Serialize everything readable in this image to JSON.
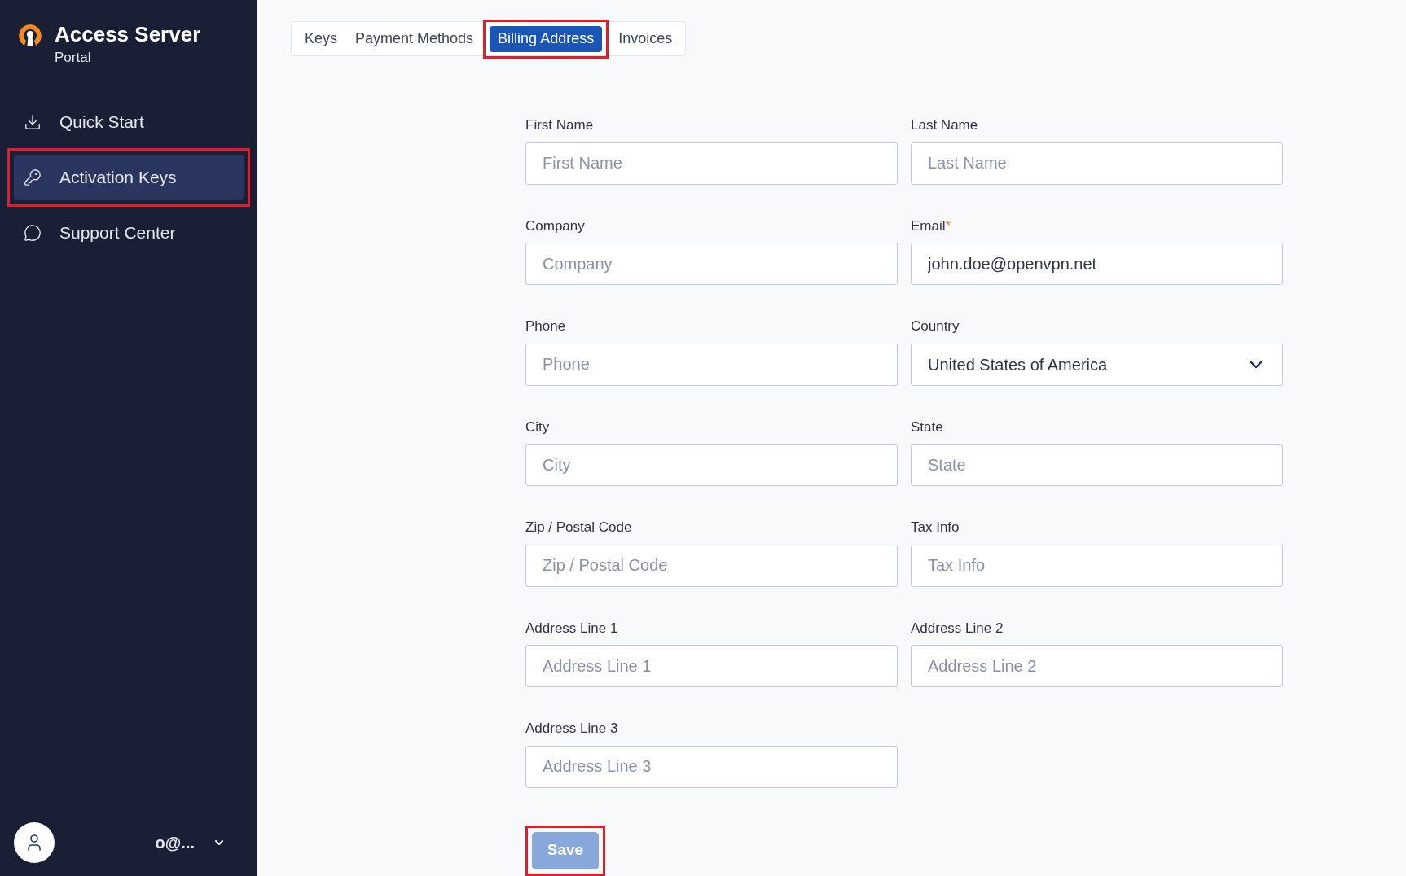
{
  "brand": {
    "title": "Access Server",
    "subtitle": "Portal"
  },
  "nav": [
    {
      "label": "Quick Start",
      "selected": false,
      "highlighted": false
    },
    {
      "label": "Activation Keys",
      "selected": true,
      "highlighted": true
    },
    {
      "label": "Support Center",
      "selected": false,
      "highlighted": false
    }
  ],
  "user": {
    "name": "o@..."
  },
  "tabs": [
    {
      "label": "Keys",
      "selected": false,
      "highlighted": false
    },
    {
      "label": "Payment Methods",
      "selected": false,
      "highlighted": false
    },
    {
      "label": "Billing Address",
      "selected": true,
      "highlighted": true
    },
    {
      "label": "Invoices",
      "selected": false,
      "highlighted": false
    }
  ],
  "fields": [
    {
      "label": "First Name",
      "kind": "text",
      "placeholder": "First Name"
    },
    {
      "label": "Last Name",
      "kind": "text",
      "placeholder": "Last Name"
    },
    {
      "label": "Company",
      "kind": "text",
      "placeholder": "Company"
    },
    {
      "label": "Email",
      "kind": "text",
      "required_mark": "*",
      "value": "john.doe@openvpn.net"
    },
    {
      "label": "Phone",
      "kind": "text",
      "placeholder": "Phone"
    },
    {
      "label": "Country",
      "kind": "select",
      "value": "United States of America"
    },
    {
      "label": "City",
      "kind": "text",
      "placeholder": "City"
    },
    {
      "label": "State",
      "kind": "text",
      "placeholder": "State"
    },
    {
      "label": "Zip / Postal Code",
      "kind": "text",
      "placeholder": "Zip / Postal Code"
    },
    {
      "label": "Tax Info",
      "kind": "text",
      "placeholder": "Tax Info"
    },
    {
      "label": "Address Line 1",
      "kind": "text",
      "placeholder": "Address Line 1"
    },
    {
      "label": "Address Line 2",
      "kind": "text",
      "placeholder": "Address Line 2"
    },
    {
      "label": "Address Line 3",
      "kind": "text",
      "placeholder": "Address Line 3"
    }
  ],
  "save": {
    "label": "Save",
    "disabled": true,
    "highlighted": true
  }
}
